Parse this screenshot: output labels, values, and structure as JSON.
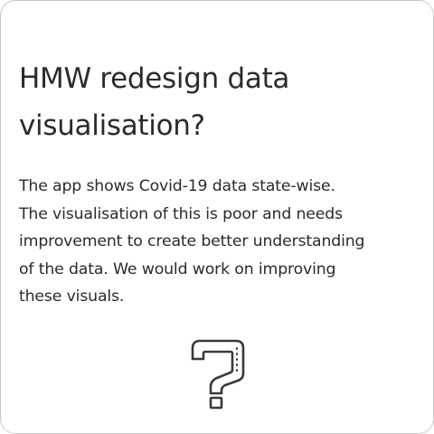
{
  "card": {
    "title_line1": "HMW redesign data",
    "title_line2": "visualisation?",
    "description_lines": [
      "The app shows Covid-19 data state-wise.",
      "The visualisation of this is poor and needs",
      "improvement to create better understanding",
      "of the data. We would work on improving",
      "these visuals."
    ],
    "icon": "question-mark-icon"
  },
  "colors": {
    "text": "#2b2b2b",
    "border": "#c9c9c9",
    "icon_stroke": "#3a3a3a"
  }
}
